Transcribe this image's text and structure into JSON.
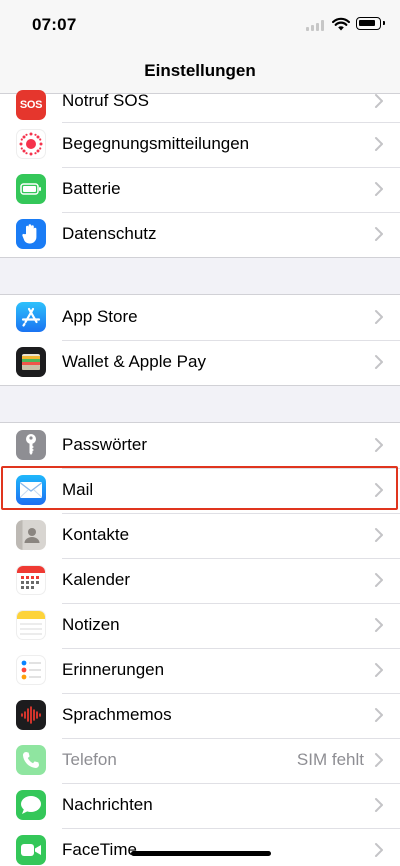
{
  "status_bar": {
    "time": "07:07"
  },
  "nav": {
    "title": "Einstellungen"
  },
  "groups": [
    {
      "items": [
        {
          "label": "Notruf SOS",
          "icon": "sos-icon",
          "icon_text": "SOS",
          "color": "#e5362d"
        },
        {
          "label": "Begegnungsmitteilungen",
          "icon": "exposure-notification-icon",
          "color": "#ffffff"
        },
        {
          "label": "Batterie",
          "icon": "battery-icon",
          "color": "#34c759"
        },
        {
          "label": "Datenschutz",
          "icon": "hand-icon",
          "color": "#1a7cf5"
        }
      ]
    },
    {
      "items": [
        {
          "label": "App Store",
          "icon": "app-store-icon",
          "color": "#1b8cf7"
        },
        {
          "label": "Wallet & Apple Pay",
          "icon": "wallet-icon",
          "color": "#1c1c1e"
        }
      ]
    },
    {
      "items": [
        {
          "label": "Passwörter",
          "icon": "key-icon",
          "color": "#8e8e93"
        },
        {
          "label": "Mail",
          "icon": "mail-icon",
          "color": "#2a8bf2"
        },
        {
          "label": "Kontakte",
          "icon": "contacts-icon",
          "color": "#c9c6c2"
        },
        {
          "label": "Kalender",
          "icon": "calendar-icon",
          "color": "#ffffff"
        },
        {
          "label": "Notizen",
          "icon": "notes-icon",
          "color": "#ffffff"
        },
        {
          "label": "Erinnerungen",
          "icon": "reminders-icon",
          "color": "#ffffff"
        },
        {
          "label": "Sprachmemos",
          "icon": "voice-memos-icon",
          "color": "#1c1c1e"
        },
        {
          "label": "Telefon",
          "detail": "SIM fehlt",
          "icon": "phone-icon",
          "color": "#8fe5a0",
          "disabled": true
        },
        {
          "label": "Nachrichten",
          "icon": "messages-icon",
          "color": "#34c759"
        },
        {
          "label": "FaceTime",
          "icon": "facetime-icon",
          "color": "#34c759"
        }
      ]
    }
  ],
  "highlight": {
    "target": "Mail",
    "color": "#e0351e"
  }
}
